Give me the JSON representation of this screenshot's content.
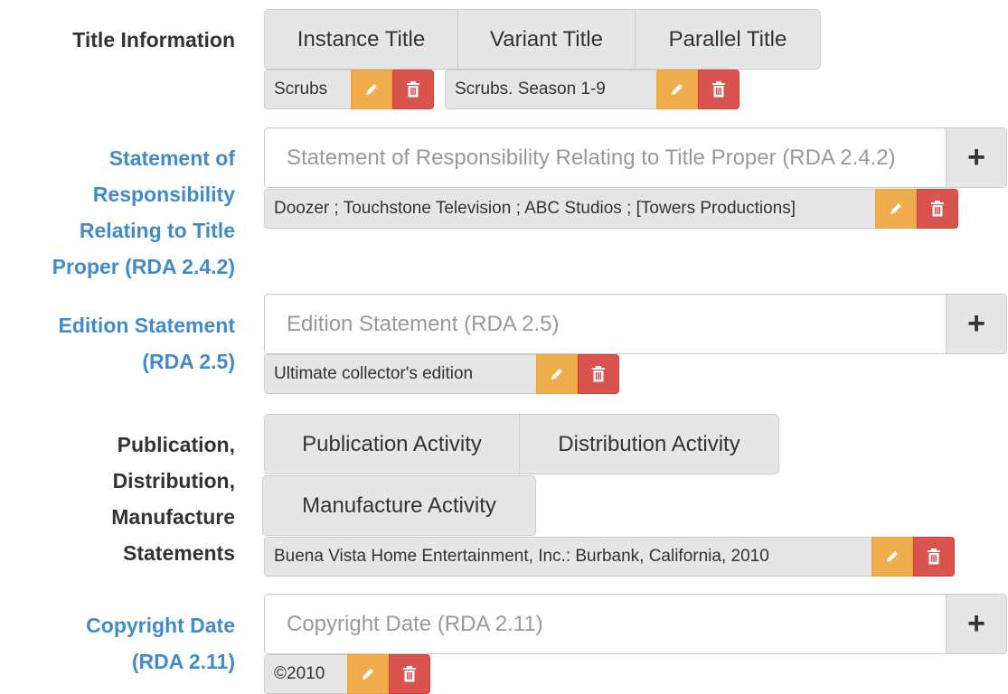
{
  "title_info": {
    "label": "Title Information",
    "tabs": [
      "Instance Title",
      "Variant Title",
      "Parallel Title"
    ],
    "tags": [
      {
        "text": "Scrubs"
      },
      {
        "text": "Scrubs. Season 1-9"
      }
    ]
  },
  "responsibility": {
    "label_lines": [
      "Statement of",
      "Responsibility",
      "Relating to Title",
      "Proper (RDA 2.4.2)"
    ],
    "placeholder": "Statement of Responsibility Relating to Title Proper (RDA 2.4.2)",
    "tag": "Doozer ; Touchstone Television ; ABC Studios ; [Towers Productions]"
  },
  "edition": {
    "label_lines": [
      "Edition Statement",
      "(RDA 2.5)"
    ],
    "placeholder": "Edition Statement (RDA 2.5)",
    "tag": "Ultimate collector's edition"
  },
  "publication": {
    "label_lines": [
      "Publication,",
      "Distribution,",
      "Manufacture",
      "Statements"
    ],
    "tabs": [
      "Publication Activity",
      "Distribution Activity",
      "Manufacture Activity"
    ],
    "tag": "Buena Vista Home Entertainment, Inc.: Burbank, California, 2010"
  },
  "copyright": {
    "label_lines": [
      "Copyright Date",
      "(RDA 2.11)"
    ],
    "placeholder": "Copyright Date (RDA 2.11)",
    "tag": "©2010"
  },
  "add_label": "+",
  "colors": {
    "link": "#428bca",
    "warning": "#f0ad4e",
    "danger": "#d9534f"
  }
}
